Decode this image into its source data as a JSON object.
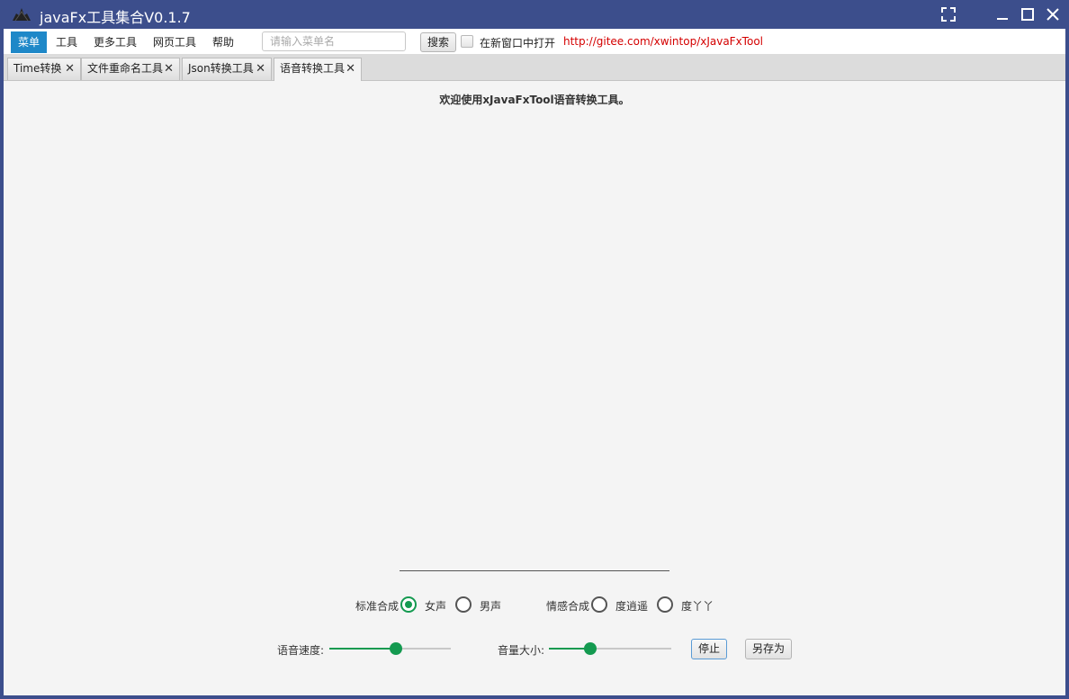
{
  "window": {
    "title": "javaFx工具集合V0.1.7"
  },
  "menubar": {
    "items": [
      {
        "label": "菜单",
        "active": true
      },
      {
        "label": "工具"
      },
      {
        "label": "更多工具"
      },
      {
        "label": "网页工具"
      },
      {
        "label": "帮助"
      }
    ],
    "search_placeholder": "请输入菜单名",
    "search_button": "搜索",
    "new_window_label": "在新窗口中打开",
    "new_window_checked": false,
    "link": "http://gitee.com/xwintop/xJavaFxTool"
  },
  "tabs": [
    {
      "label": "Time转换"
    },
    {
      "label": "文件重命名工具"
    },
    {
      "label": "Json转换工具"
    },
    {
      "label": "语音转换工具",
      "selected": true
    }
  ],
  "main": {
    "welcome": "欢迎使用xJavaFxTool语音转换工具。",
    "standard_label": "标准合成",
    "standard_options": [
      {
        "label": "女声",
        "checked": true
      },
      {
        "label": "男声",
        "checked": false
      }
    ],
    "emotion_label": "情感合成",
    "emotion_options": [
      {
        "label": "度逍遥",
        "checked": false
      },
      {
        "label": "度丫丫",
        "checked": false
      }
    ],
    "speed_label": "语音速度:",
    "speed_value": 0.55,
    "volume_label": "音量大小:",
    "volume_value": 0.34,
    "stop_button": "停止",
    "saveas_button": "另存为"
  },
  "colors": {
    "titlebar": "#3c4e8c",
    "accent": "#149a50",
    "menu_active": "#1e88c8",
    "link": "#d40000"
  }
}
